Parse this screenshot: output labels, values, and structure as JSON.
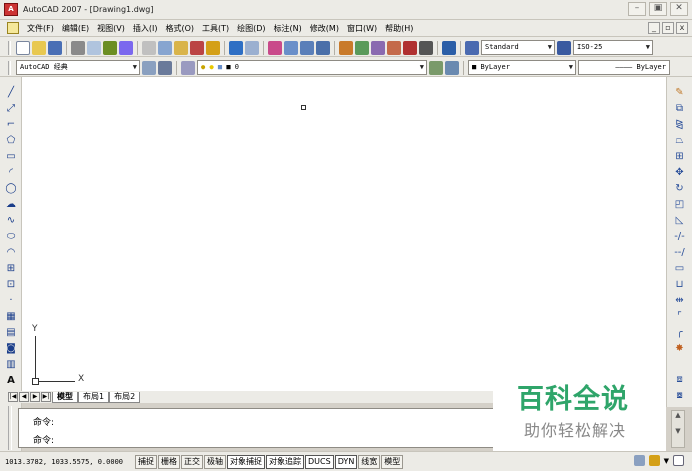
{
  "window": {
    "title": "AutoCAD 2007 - [Drawing1.dwg]",
    "app_icon_text": "A",
    "controls": [
      "–",
      "▣",
      "✕"
    ]
  },
  "menubar": {
    "items": [
      "文件(F)",
      "编辑(E)",
      "视图(V)",
      "插入(I)",
      "格式(O)",
      "工具(T)",
      "绘图(D)",
      "标注(N)",
      "修改(M)",
      "窗口(W)",
      "帮助(H)"
    ],
    "doc_controls": [
      "_",
      "▫",
      "x"
    ]
  },
  "toolbar1": {
    "text_style": "Standard",
    "dim_style": "ISO-25"
  },
  "toolbar2": {
    "workspace": "AutoCAD 经典",
    "layer": "0",
    "color": "ByLayer",
    "linetype": "ByLayer"
  },
  "draw_toolbar": {
    "icons": [
      "line-icon",
      "construction-line-icon",
      "polyline-icon",
      "polygon-icon",
      "rectangle-icon",
      "arc-icon",
      "circle-icon",
      "revision-cloud-icon",
      "spline-icon",
      "ellipse-icon",
      "ellipse-arc-icon",
      "insert-block-icon",
      "make-block-icon",
      "point-icon",
      "hatch-icon",
      "gradient-icon",
      "region-icon",
      "table-icon",
      "multiline-text-icon"
    ]
  },
  "modify_toolbar": {
    "icons": [
      "erase-icon",
      "copy-icon",
      "mirror-icon",
      "offset-icon",
      "array-icon",
      "move-icon",
      "rotate-icon",
      "scale-icon",
      "stretch-icon",
      "trim-icon",
      "extend-icon",
      "break-at-point-icon",
      "break-icon",
      "join-icon",
      "chamfer-icon",
      "fillet-icon",
      "explode-icon"
    ]
  },
  "ucs": {
    "x_label": "X",
    "y_label": "Y"
  },
  "layout_tabs": [
    "模型",
    "布局1",
    "布局2"
  ],
  "command": {
    "line1": "命令:",
    "line2": "命令:"
  },
  "status": {
    "coordinates": "1013.3782, 1033.5575, 0.0000",
    "toggles": [
      "捕捉",
      "栅格",
      "正交",
      "极轴",
      "对象捕捉",
      "对象追踪",
      "DUCS",
      "DYN",
      "线宽",
      "模型"
    ]
  },
  "watermark": {
    "title": "百科全说",
    "subtitle": "助你轻松解决"
  },
  "colors": {
    "canvas": "#ffffff",
    "chrome": "#ecebe6",
    "watermark_green": "#2fa56a"
  }
}
